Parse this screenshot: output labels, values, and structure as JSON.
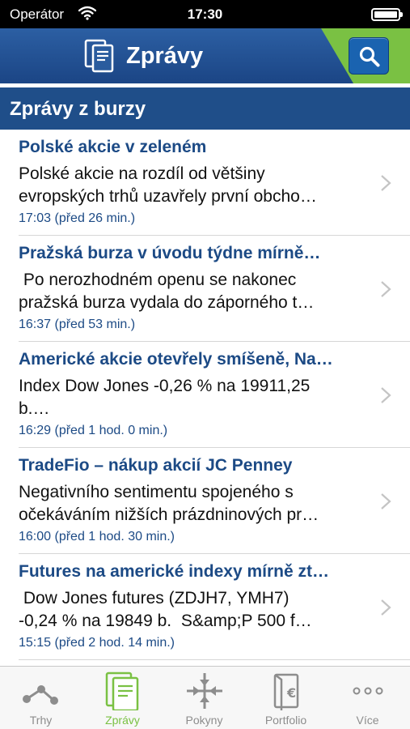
{
  "status_bar": {
    "carrier": "Operátor",
    "time": "17:30"
  },
  "nav": {
    "title": "Zprávy"
  },
  "section": {
    "title": "Zprávy z burzy"
  },
  "news": [
    {
      "headline": "Polské akcie v zeleném",
      "summary_lines": [
        "Polské akcie na rozdíl od většiny",
        "evropských trhů uzavřely první obcho…"
      ],
      "time": "17:03 (před 26 min.)"
    },
    {
      "headline": "Pražská burza v úvodu týdne mírně…",
      "summary_lines": [
        " Po nerozhodném openu se nakonec",
        "pražská burza vydala do záporného t…"
      ],
      "time": "16:37 (před 53 min.)"
    },
    {
      "headline": "Americké akcie otevřely smíšeně, Na…",
      "summary_lines": [
        "Index Dow Jones -0,26 % na 19911,25",
        "b.…"
      ],
      "time": "16:29 (před 1 hod. 0 min.)"
    },
    {
      "headline": "TradeFio – nákup akcií JC Penney",
      "summary_lines": [
        "Negativního sentimentu spojeného s",
        "očekáváním nižších prázdninových pr…"
      ],
      "time": "16:00 (před 1 hod. 30 min.)"
    },
    {
      "headline": "Futures na americké indexy mírně zt…",
      "summary_lines": [
        " Dow Jones futures (ZDJH7, YMH7)",
        "-0,24 % na 19849 b.  S&amp;P 500 f…"
      ],
      "time": "15:15 (před 2 hod. 14 min.)"
    }
  ],
  "tabs": [
    {
      "label": "Trhy",
      "icon": "markets-icon",
      "active": false
    },
    {
      "label": "Zprávy",
      "icon": "news-icon",
      "active": true
    },
    {
      "label": "Pokyny",
      "icon": "orders-icon",
      "active": false
    },
    {
      "label": "Portfolio",
      "icon": "portfolio-icon",
      "active": false
    },
    {
      "label": "Více",
      "icon": "more-icon",
      "active": false
    }
  ],
  "colors": {
    "nav_blue": "#1b4585",
    "accent_green": "#7ac143",
    "headline_blue": "#1c4a85"
  }
}
